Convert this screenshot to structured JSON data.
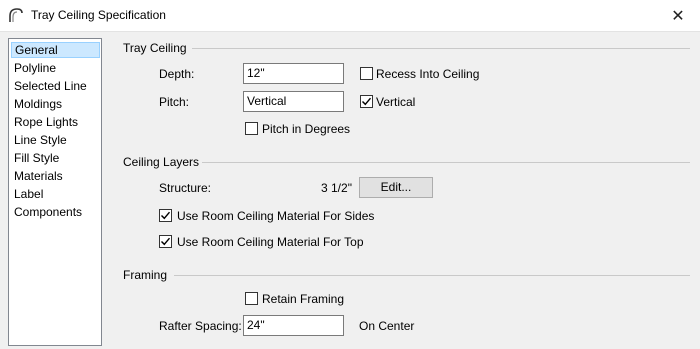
{
  "window": {
    "title": "Tray Ceiling Specification",
    "close_glyph": "✕",
    "icon": "arch-icon"
  },
  "sidebar": {
    "items": [
      {
        "label": "General",
        "selected": true
      },
      {
        "label": "Polyline"
      },
      {
        "label": "Selected Line"
      },
      {
        "label": "Moldings"
      },
      {
        "label": "Rope Lights"
      },
      {
        "label": "Line Style"
      },
      {
        "label": "Fill Style"
      },
      {
        "label": "Materials"
      },
      {
        "label": "Label"
      },
      {
        "label": "Components"
      }
    ]
  },
  "tray_ceiling": {
    "title": "Tray Ceiling",
    "depth_label": "Depth:",
    "depth_value": "12\"",
    "recess_label": "Recess Into Ceiling",
    "recess_checked": false,
    "pitch_label": "Pitch:",
    "pitch_value": "Vertical",
    "vertical_label": "Vertical",
    "vertical_checked": true,
    "pitch_degrees_label": "Pitch in Degrees",
    "pitch_degrees_checked": false
  },
  "ceiling_layers": {
    "title": "Ceiling Layers",
    "structure_label": "Structure:",
    "structure_value": "3 1/2\"",
    "edit_label": "Edit...",
    "sides_label": "Use Room Ceiling Material For Sides",
    "sides_checked": true,
    "top_label": "Use Room Ceiling Material For Top",
    "top_checked": true
  },
  "framing": {
    "title": "Framing",
    "retain_label": "Retain Framing",
    "retain_checked": false,
    "rafter_label": "Rafter Spacing:",
    "rafter_value": "24\"",
    "on_center_label": "On Center"
  }
}
